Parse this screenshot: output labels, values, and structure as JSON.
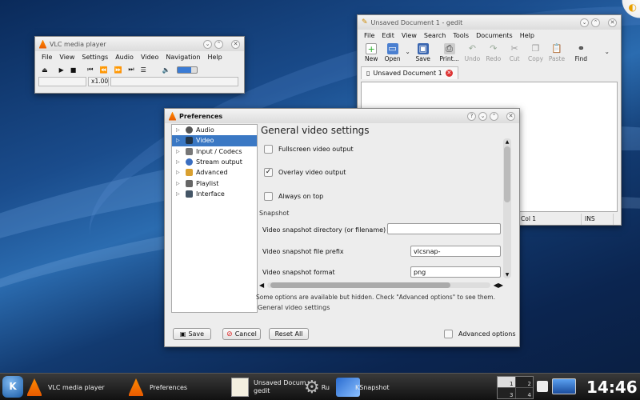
{
  "vlc": {
    "title": "VLC media player",
    "menu": [
      "File",
      "View",
      "Settings",
      "Audio",
      "Video",
      "Navigation",
      "Help"
    ],
    "speed": "x1.00"
  },
  "gedit": {
    "title": "Unsaved Document 1 - gedit",
    "menu": [
      "File",
      "Edit",
      "View",
      "Search",
      "Tools",
      "Documents",
      "Help"
    ],
    "toolbar": [
      "New",
      "Open",
      "Save",
      "Print...",
      "Undo",
      "Redo",
      "Cut",
      "Copy",
      "Paste",
      "Find"
    ],
    "tab": "Unsaved Document 1",
    "status_col": "Col 1",
    "status_mode": "INS"
  },
  "prefs": {
    "title": "Preferences",
    "tree": [
      "Audio",
      "Video",
      "Input / Codecs",
      "Stream output",
      "Advanced",
      "Playlist",
      "Interface"
    ],
    "pane_title": "General video settings",
    "fullscreen": "Fullscreen video output",
    "overlay": "Overlay video output",
    "always_on_top": "Always on top",
    "snapshot_section": "Snapshot",
    "snap_dir_label": "Video snapshot directory (or filename)",
    "snap_dir_value": "",
    "snap_prefix_label": "Video snapshot file prefix",
    "snap_prefix_value": "vlcsnap-",
    "snap_format_label": "Video snapshot format",
    "snap_format_value": "png",
    "hidden_msg": "Some options are available but hidden. Check \"Advanced options\" to see them.",
    "bottom_title": "General video settings",
    "save": "Save",
    "cancel": "Cancel",
    "reset": "Reset All",
    "advanced": "Advanced options"
  },
  "taskbar": {
    "kmenu": "K",
    "tasks": [
      "VLC media player",
      "Preferences",
      "Unsaved Docum",
      "gedit",
      "Ru",
      "KSnapshot"
    ],
    "pager": [
      "1",
      "2",
      "3",
      "4"
    ],
    "clock": "14:46"
  },
  "colors": {
    "selection": "#3a78c4",
    "vlc_orange": "#ff8a00"
  }
}
